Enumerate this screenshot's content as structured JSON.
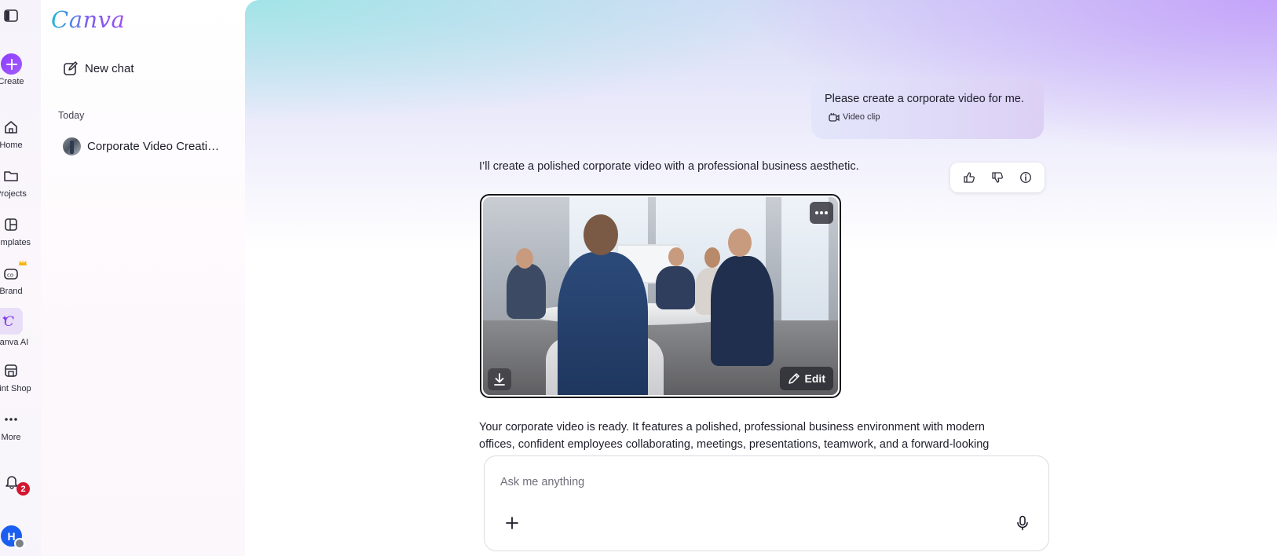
{
  "app": {
    "logo": "Canva"
  },
  "rail": {
    "create_label": "Create",
    "items": [
      {
        "label": "Home",
        "icon": "home-icon"
      },
      {
        "label": "Projects",
        "icon": "folder-icon"
      },
      {
        "label": "Templates",
        "icon": "templates-icon"
      },
      {
        "label": "Brand",
        "icon": "brand-icon"
      },
      {
        "label": "Canva AI",
        "icon": "canva-ai-icon"
      },
      {
        "label": "Print Shop",
        "icon": "print-shop-icon"
      },
      {
        "label": "More",
        "icon": "more-icon"
      }
    ],
    "notifications_count": "2",
    "avatar_initial": "H"
  },
  "panel": {
    "new_chat_label": "New chat",
    "section_today": "Today",
    "history": [
      {
        "title": "Corporate Video Creati…"
      }
    ]
  },
  "chat": {
    "user_message": "Please create a corporate video for me.",
    "user_attachment": "Video clip",
    "assistant_intro": "I’ll create a polished corporate video with a professional business aesthetic.",
    "video_edit_label": "Edit",
    "assistant_followup": "Your corporate video is ready. It features a polished, professional business environment with modern offices, confident employees collaborating, meetings, presentations, teamwork, and a forward-looking"
  },
  "composer": {
    "placeholder": "Ask me anything",
    "value": ""
  },
  "colors": {
    "accent": "#8b3dff",
    "badge": "#d3172f",
    "avatar": "#1a5ff0"
  }
}
